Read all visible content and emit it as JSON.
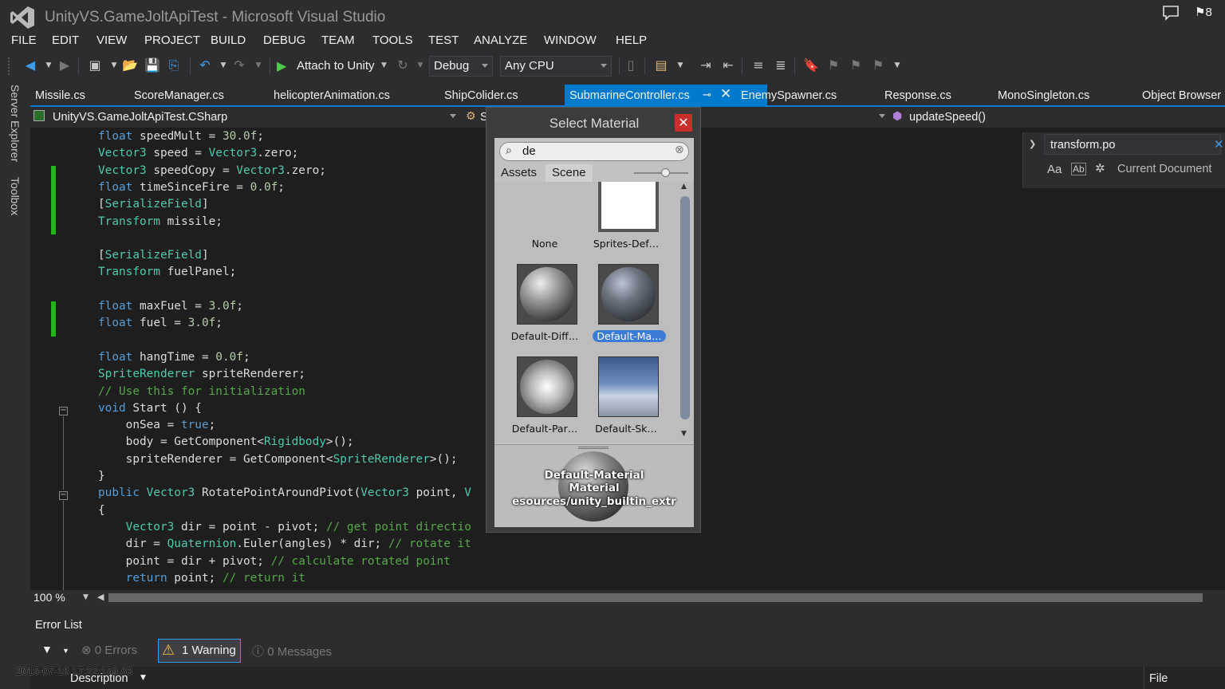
{
  "window": {
    "title": "UnityVS.GameJoltApiTest - Microsoft Visual Studio",
    "notification_count": "8"
  },
  "menu": [
    "FILE",
    "EDIT",
    "VIEW",
    "PROJECT",
    "BUILD",
    "DEBUG",
    "TEAM",
    "TOOLS",
    "TEST",
    "ANALYZE",
    "WINDOW",
    "HELP"
  ],
  "toolbar": {
    "attach_label": "Attach to Unity",
    "config": "Debug",
    "platform": "Any CPU"
  },
  "side_tabs": [
    "Server Explorer",
    "Toolbox"
  ],
  "tabs": [
    "Missile.cs",
    "ScoreManager.cs",
    "helicopterAnimation.cs",
    "ShipColider.cs",
    "SubmarineController.cs",
    "EnemySpawner.cs",
    "Response.cs",
    "MonoSingleton.cs",
    "Object Browser"
  ],
  "active_tab": "SubmarineController.cs",
  "navbar": {
    "project": "UnityVS.GameJoltApiTest.CSharp",
    "member_partial": "S",
    "method": "updateSpeed()"
  },
  "find": {
    "query": "transform.po",
    "opt_case": "Aa",
    "opt_word": "Ab",
    "scope": "Current Document"
  },
  "code": [
    [
      [
        "kw",
        "float"
      ],
      [
        "t",
        " speedMult = "
      ],
      [
        "nm",
        "30.0f"
      ],
      [
        "t",
        ";"
      ]
    ],
    [
      [
        "ty",
        "Vector3"
      ],
      [
        "t",
        " speed = "
      ],
      [
        "ty",
        "Vector3"
      ],
      [
        "t",
        ".zero;"
      ]
    ],
    [
      [
        "ty",
        "Vector3"
      ],
      [
        "t",
        " speedCopy = "
      ],
      [
        "ty",
        "Vector3"
      ],
      [
        "t",
        ".zero;"
      ]
    ],
    [
      [
        "kw",
        "float"
      ],
      [
        "t",
        " timeSinceFire = "
      ],
      [
        "nm",
        "0.0f"
      ],
      [
        "t",
        ";"
      ]
    ],
    [
      [
        "t",
        "["
      ],
      [
        "ty",
        "SerializeField"
      ],
      [
        "t",
        "]"
      ]
    ],
    [
      [
        "ty",
        "Transform"
      ],
      [
        "t",
        " missile;"
      ]
    ],
    [],
    [
      [
        "t",
        "["
      ],
      [
        "ty",
        "SerializeField"
      ],
      [
        "t",
        "]"
      ]
    ],
    [
      [
        "ty",
        "Transform"
      ],
      [
        "t",
        " fuelPanel;"
      ]
    ],
    [],
    [
      [
        "kw",
        "float"
      ],
      [
        "t",
        " maxFuel = "
      ],
      [
        "nm",
        "3.0f"
      ],
      [
        "t",
        ";"
      ]
    ],
    [
      [
        "kw",
        "float"
      ],
      [
        "t",
        " fuel = "
      ],
      [
        "nm",
        "3.0f"
      ],
      [
        "t",
        ";"
      ]
    ],
    [],
    [
      [
        "kw",
        "float"
      ],
      [
        "t",
        " hangTime = "
      ],
      [
        "nm",
        "0.0f"
      ],
      [
        "t",
        ";"
      ]
    ],
    [
      [
        "ty",
        "SpriteRenderer"
      ],
      [
        "t",
        " spriteRenderer;"
      ]
    ],
    [
      [
        "cm",
        "// Use this for initialization"
      ]
    ],
    [
      [
        "kw",
        "void"
      ],
      [
        "t",
        " Start () {"
      ]
    ],
    [
      [
        "t",
        "    onSea = "
      ],
      [
        "kw",
        "true"
      ],
      [
        "t",
        ";"
      ]
    ],
    [
      [
        "t",
        "    body = GetComponent<"
      ],
      [
        "ty",
        "Rigidbody"
      ],
      [
        "t",
        ">();"
      ]
    ],
    [
      [
        "t",
        "    spriteRenderer = GetComponent<"
      ],
      [
        "ty",
        "SpriteRenderer"
      ],
      [
        "t",
        ">();"
      ]
    ],
    [
      [
        "t",
        "}"
      ]
    ],
    [
      [
        "kw",
        "public"
      ],
      [
        "t",
        " "
      ],
      [
        "ty",
        "Vector3"
      ],
      [
        "t",
        " RotatePointAroundPivot("
      ],
      [
        "ty",
        "Vector3"
      ],
      [
        "t",
        " point, "
      ],
      [
        "ty",
        "V"
      ]
    ],
    [
      [
        "t",
        "{"
      ]
    ],
    [
      [
        "t",
        "    "
      ],
      [
        "ty",
        "Vector3"
      ],
      [
        "t",
        " dir = point - pivot; "
      ],
      [
        "cm",
        "// get point directio"
      ]
    ],
    [
      [
        "t",
        "    dir = "
      ],
      [
        "ty",
        "Quaternion"
      ],
      [
        "t",
        ".Euler(angles) * dir; "
      ],
      [
        "cm",
        "// rotate it"
      ]
    ],
    [
      [
        "t",
        "    point = dir + pivot; "
      ],
      [
        "cm",
        "// calculate rotated point"
      ]
    ],
    [
      [
        "t",
        "    "
      ],
      [
        "kw",
        "return"
      ],
      [
        "t",
        " point; "
      ],
      [
        "cm",
        "// return it"
      ]
    ]
  ],
  "zoom": "100 %",
  "error_list": {
    "title": "Error List",
    "errors": "0 Errors",
    "warnings": "1 Warning",
    "messages": "0 Messages",
    "col_description": "Description",
    "col_file": "File"
  },
  "timestamp": "2015-07-18 17:22:159.83",
  "dialog": {
    "title": "Select Material",
    "search_value": "de",
    "tab_assets": "Assets",
    "tab_scene": "Scene",
    "items": [
      "None",
      "Sprites-Def…",
      "Default-Diff…",
      "Default-Ma…",
      "Default-Par…",
      "Default-Sk…"
    ],
    "selected_item": "Default-Ma…",
    "preview_name": "Default-Material",
    "preview_type": "Material",
    "preview_path": "esources/unity_builtin_extr"
  },
  "colors": {
    "accent": "#007acc",
    "change_marker": "#24b41c",
    "close_red": "#c9302c",
    "selection": "#3d7bd8"
  }
}
